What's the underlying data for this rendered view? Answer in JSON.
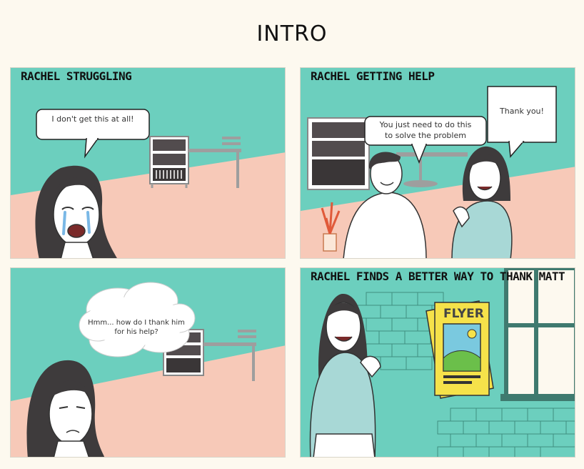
{
  "page": {
    "title": "INTRO"
  },
  "panels": [
    {
      "caption": "RACHEL STRUGGLING",
      "speech": "I don't get this at all!"
    },
    {
      "caption": "RACHEL GETTING HELP",
      "speech_matt_line1": "You just need to do this",
      "speech_matt_line2": "to solve the problem",
      "speech_rachel": "Thank you!"
    },
    {
      "caption": "",
      "thought_line1": "Hmm... how do I thank him",
      "thought_line2": "for his help?"
    },
    {
      "caption": "RACHEL FINDS A BETTER WAY TO THANK MATT",
      "flyer_label": "FLYER"
    }
  ],
  "colors": {
    "wall_teal": "#6ccfbe",
    "floor_pink": "#f7c9b8",
    "flyer_yellow": "#f6e24a",
    "hair": "#3e3b3c"
  }
}
